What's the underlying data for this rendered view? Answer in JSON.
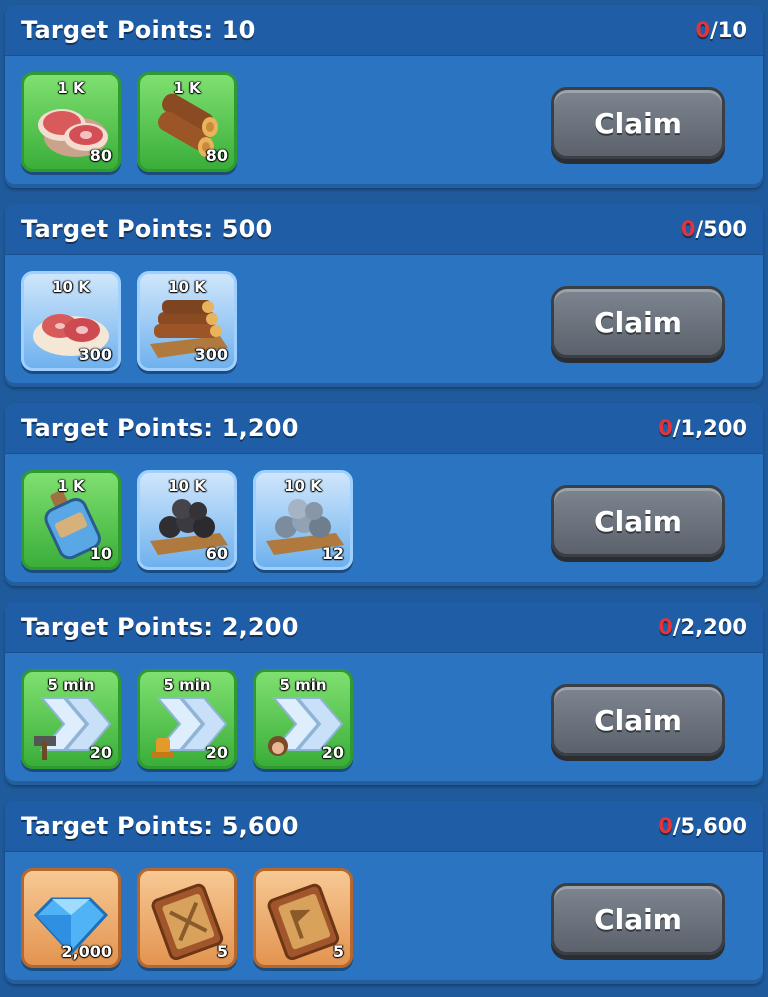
{
  "colors": {
    "background": "#1f5b9c",
    "card": "#2b74c2",
    "header": "#1f5ea7",
    "progress_current": "#e2343a",
    "claim_button": "#6b727c",
    "frame_green": "#3aae3a",
    "frame_blue": "#6fb1ee",
    "frame_orange": "#e39450"
  },
  "tiers": [
    {
      "title": "Target Points: 10",
      "progress_current": "0",
      "progress_total": "/10",
      "claim_label": "Claim",
      "rewards": [
        {
          "icon": "meat-icon",
          "frame": "green",
          "amount": "1 K",
          "count": "80"
        },
        {
          "icon": "wood-logs-icon",
          "frame": "green",
          "amount": "1 K",
          "count": "80"
        }
      ]
    },
    {
      "title": "Target Points: 500",
      "progress_current": "0",
      "progress_total": "/500",
      "claim_label": "Claim",
      "rewards": [
        {
          "icon": "meat-platter-icon",
          "frame": "blue",
          "amount": "10 K",
          "count": "300"
        },
        {
          "icon": "wood-pallet-icon",
          "frame": "blue",
          "amount": "10 K",
          "count": "300"
        }
      ]
    },
    {
      "title": "Target Points: 1,200",
      "progress_current": "0",
      "progress_total": "/1,200",
      "claim_label": "Claim",
      "rewards": [
        {
          "icon": "exp-potion-icon",
          "frame": "green",
          "amount": "1 K",
          "count": "10"
        },
        {
          "icon": "coal-pallet-icon",
          "frame": "blue",
          "amount": "10 K",
          "count": "60"
        },
        {
          "icon": "iron-ore-pallet-icon",
          "frame": "blue",
          "amount": "10 K",
          "count": "12"
        }
      ]
    },
    {
      "title": "Target Points: 2,200",
      "progress_current": "0",
      "progress_total": "/2,200",
      "claim_label": "Claim",
      "rewards": [
        {
          "icon": "speedup-build-icon",
          "frame": "green",
          "amount": "5 min",
          "count": "20"
        },
        {
          "icon": "speedup-research-icon",
          "frame": "green",
          "amount": "5 min",
          "count": "20"
        },
        {
          "icon": "speedup-training-icon",
          "frame": "green",
          "amount": "5 min",
          "count": "20"
        }
      ]
    },
    {
      "title": "Target Points: 5,600",
      "progress_current": "0",
      "progress_total": "/5,600",
      "claim_label": "Claim",
      "rewards": [
        {
          "icon": "gem-icon",
          "frame": "orange",
          "amount": "",
          "count": "2,000"
        },
        {
          "icon": "combat-book-icon",
          "frame": "orange",
          "amount": "",
          "count": "5"
        },
        {
          "icon": "flag-book-icon",
          "frame": "orange",
          "amount": "",
          "count": "5"
        }
      ]
    }
  ]
}
